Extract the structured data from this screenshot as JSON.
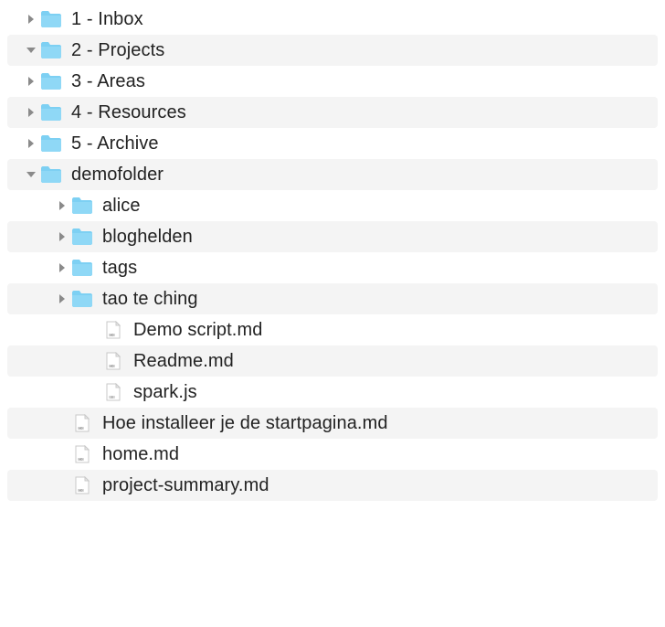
{
  "tree": [
    {
      "label": "1 - Inbox",
      "type": "folder",
      "expanded": false,
      "indent": 0,
      "alt": false
    },
    {
      "label": "2 - Projects",
      "type": "folder",
      "expanded": true,
      "indent": 0,
      "alt": true
    },
    {
      "label": "3 - Areas",
      "type": "folder",
      "expanded": false,
      "indent": 0,
      "alt": false
    },
    {
      "label": "4 - Resources",
      "type": "folder",
      "expanded": false,
      "indent": 0,
      "alt": true
    },
    {
      "label": "5 - Archive",
      "type": "folder",
      "expanded": false,
      "indent": 0,
      "alt": false
    },
    {
      "label": "demofolder",
      "type": "folder",
      "expanded": true,
      "indent": 0,
      "alt": true
    },
    {
      "label": "alice",
      "type": "folder",
      "expanded": false,
      "indent": 1,
      "alt": false
    },
    {
      "label": "bloghelden",
      "type": "folder",
      "expanded": false,
      "indent": 1,
      "alt": true
    },
    {
      "label": "tags",
      "type": "folder",
      "expanded": false,
      "indent": 1,
      "alt": false
    },
    {
      "label": "tao te ching",
      "type": "folder",
      "expanded": false,
      "indent": 1,
      "alt": true
    },
    {
      "label": "Demo script.md",
      "type": "md",
      "expanded": null,
      "indent": 2,
      "alt": false
    },
    {
      "label": "Readme.md",
      "type": "md",
      "expanded": null,
      "indent": 2,
      "alt": true
    },
    {
      "label": "spark.js",
      "type": "js",
      "expanded": null,
      "indent": 2,
      "alt": false
    },
    {
      "label": "Hoe installeer je de startpagina.md",
      "type": "md",
      "expanded": null,
      "indent": 1,
      "alt": true
    },
    {
      "label": "home.md",
      "type": "md",
      "expanded": null,
      "indent": 1,
      "alt": false
    },
    {
      "label": "project-summary.md",
      "type": "md",
      "expanded": null,
      "indent": 1,
      "alt": true
    }
  ],
  "icons": {
    "folder_color": "#7dd0f3",
    "folder_shadow": "#56bfe8"
  }
}
